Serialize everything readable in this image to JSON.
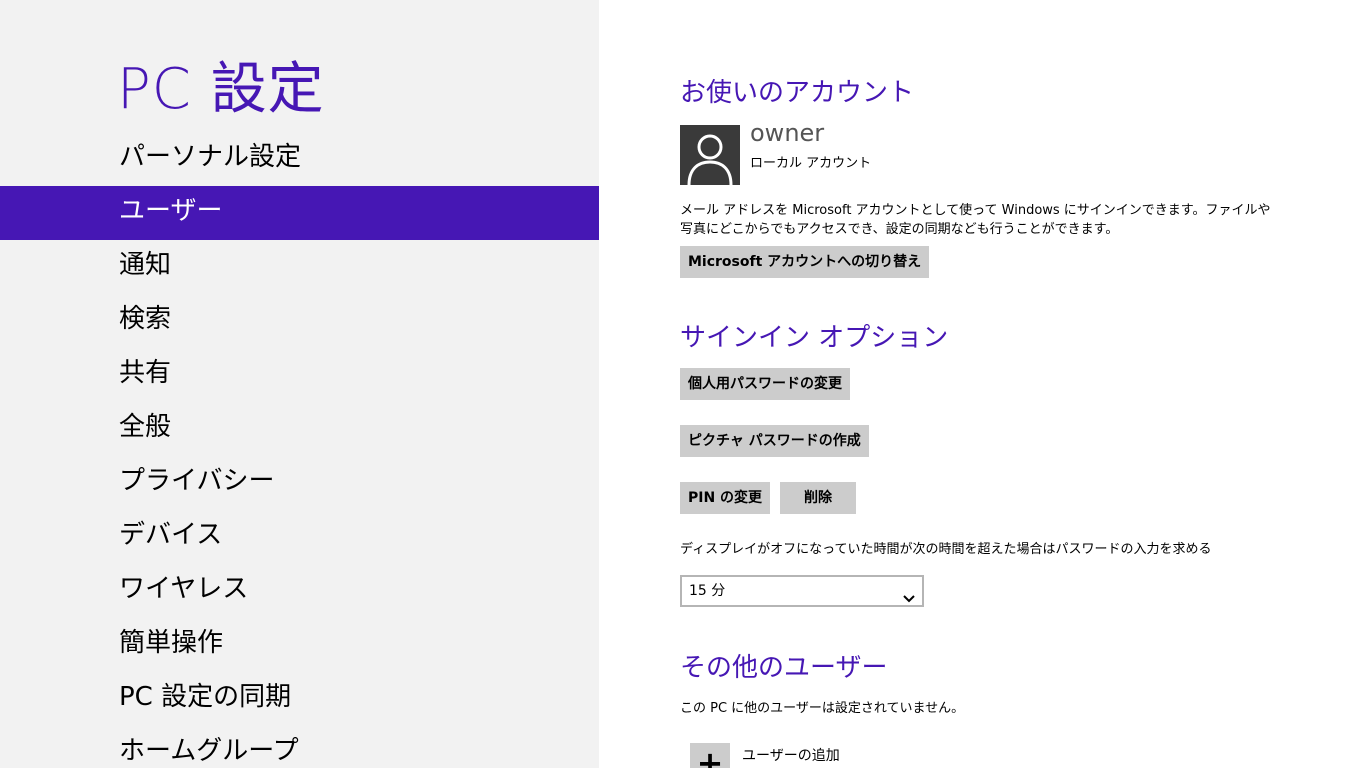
{
  "sidebar": {
    "title": "PC 設定",
    "items": [
      {
        "label": "パーソナル設定"
      },
      {
        "label": "ユーザー",
        "selected": true
      },
      {
        "label": "通知"
      },
      {
        "label": "検索"
      },
      {
        "label": "共有"
      },
      {
        "label": "全般"
      },
      {
        "label": "プライバシー"
      },
      {
        "label": "デバイス"
      },
      {
        "label": "ワイヤレス"
      },
      {
        "label": "簡単操作"
      },
      {
        "label": "PC 設定の同期"
      },
      {
        "label": "ホームグループ"
      }
    ]
  },
  "account": {
    "heading": "お使いのアカウント",
    "user_name": "owner",
    "account_type": "ローカル アカウント",
    "avatar_icon": "user-silhouette-icon",
    "description": "メール アドレスを Microsoft アカウントとして使って Windows にサインインできます。ファイルや写真にどこからでもアクセスでき、設定の同期なども行うことができます。",
    "switch_button": "Microsoft アカウントへの切り替え"
  },
  "signin": {
    "heading": "サインイン オプション",
    "change_password_button": "個人用パスワードの変更",
    "picture_password_button": "ピクチャ パスワードの作成",
    "change_pin_button": "PIN の変更",
    "delete_pin_button": "削除",
    "timeout_label": "ディスプレイがオフになっていた時間が次の時間を超えた場合はパスワードの入力を求める",
    "timeout_value": "15 分",
    "dropdown_icon": "chevron-down-icon"
  },
  "other_users": {
    "heading": "その他のユーザー",
    "none_text": "この PC に他のユーザーは設定されていません。",
    "add_icon": "plus-icon",
    "add_label": "ユーザーの追加"
  },
  "colors": {
    "accent": "#4617b4",
    "sidebar_bg": "#f2f2f2",
    "button_bg": "#cccccc"
  }
}
